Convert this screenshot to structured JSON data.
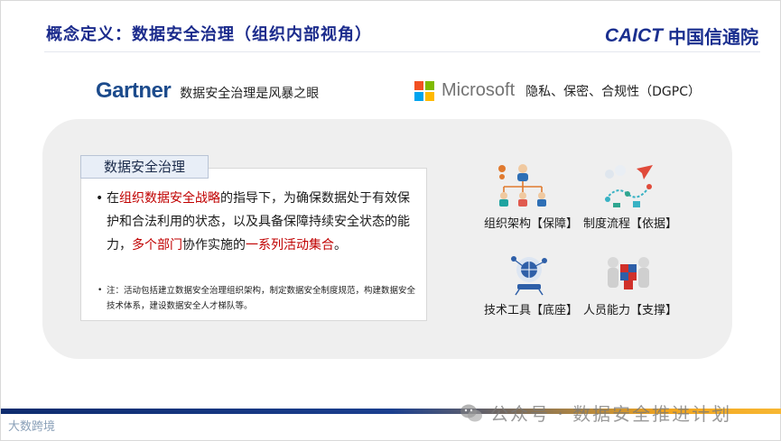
{
  "header": {
    "title": "概念定义：数据安全治理（组织内部视角）",
    "org_logo_mark": "CAICT",
    "org_logo_cn": "中国信通院"
  },
  "sources": {
    "gartner": {
      "logo": "Gartner",
      "text": "数据安全治理是风暴之眼"
    },
    "microsoft": {
      "logo": "Microsoft",
      "text": "隐私、保密、合规性（DGPC）"
    }
  },
  "definition": {
    "title": "数据安全治理",
    "main": {
      "p1": "在",
      "r1": "组织数据安全战略",
      "p2": "的指导下，为确保数据处于有效保护和合法利用的状态，以及具备保障持续安全状态的能力，",
      "r2": "多个部门",
      "p3": "协作实施的",
      "r3": "一系列活动集合",
      "p4": "。"
    },
    "note": "注：活动包括建立数据安全治理组织架构，制定数据安全制度规范，构建数据安全技术体系，建设数据安全人才梯队等。"
  },
  "pillars": [
    {
      "label": "组织架构【保障】",
      "icon": "org-chart-icon"
    },
    {
      "label": "制度流程【依据】",
      "icon": "process-icon"
    },
    {
      "label": "技术工具【底座】",
      "icon": "tech-tool-icon"
    },
    {
      "label": "人员能力【支撑】",
      "icon": "people-puzzle-icon"
    }
  ],
  "footer": {
    "brand": "大数跨境",
    "watermark": "公众号 · 数据安全推进计划"
  },
  "colors": {
    "title_blue": "#1b2b8c",
    "highlight_red": "#c00000",
    "ms_red": "#f25022",
    "ms_green": "#7fba00",
    "ms_blue": "#00a4ef",
    "ms_yellow": "#ffb900"
  }
}
